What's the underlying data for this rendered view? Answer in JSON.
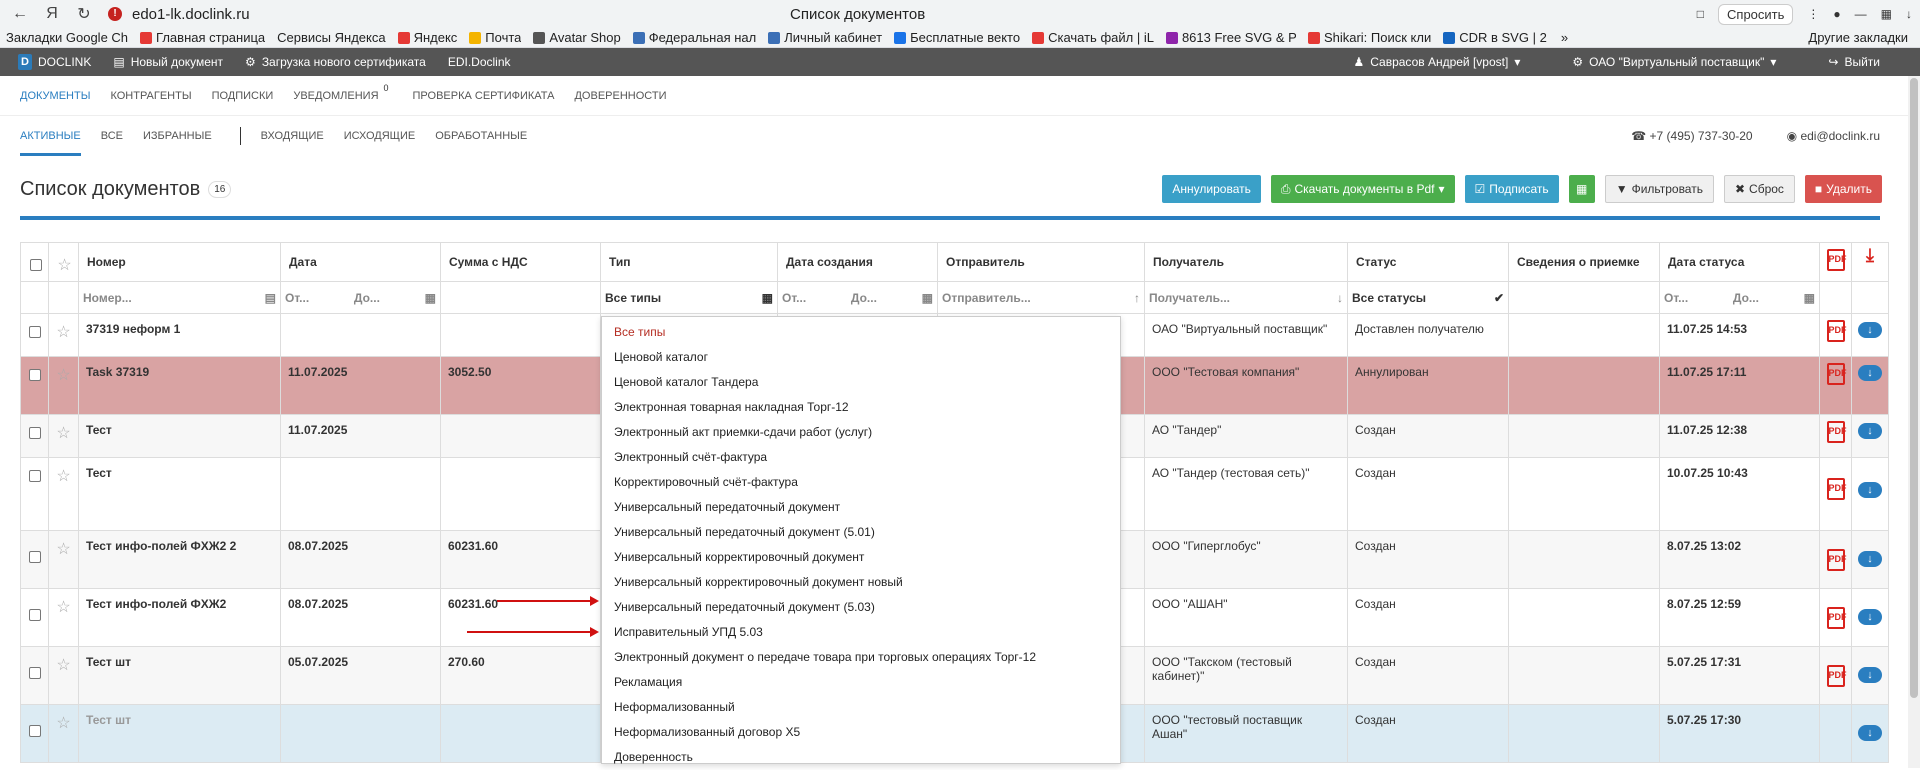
{
  "browser": {
    "url": "edo1-lk.doclink.ru",
    "tab_title": "Список документов",
    "ask_label": "Спросить",
    "bookmarks": [
      "Закладки Google Ch",
      "Главная страница",
      "Сервисы Яндекса",
      "Яндекс",
      "Почта",
      "Avatar Shop",
      "Федеральная нал",
      "Личный кабинет",
      "Бесплатные векто",
      "Скачать файл | iL",
      "8613 Free SVG & P",
      "Shikari: Поиск кли",
      "CDR в SVG | 2"
    ],
    "other_bookmarks": "Другие закладки"
  },
  "appbar": {
    "brand": "DOCLINK",
    "new_doc": "Новый документ",
    "upload_cert": "Загрузка нового сертификата",
    "edi": "EDI.Doclink",
    "user": "Саврасов Андрей [vpost]",
    "org": "ОАО \"Виртуальный поставщик\"",
    "logout": "Выйти"
  },
  "mainnav": [
    "ДОКУМЕНТЫ",
    "КОНТРАГЕНТЫ",
    "ПОДПИСКИ",
    "УВЕДОМЛЕНИЯ",
    "ПРОВЕРКА СЕРТИФИКАТА",
    "ДОВЕРЕННОСТИ"
  ],
  "notifications_count": "0",
  "subnav": [
    "АКТИВНЫЕ",
    "ВСЕ",
    "ИЗБРАННЫЕ",
    "ВХОДЯЩИЕ",
    "ИСХОДЯЩИЕ",
    "ОБРАБОТАННЫЕ"
  ],
  "contacts": {
    "phone": "+7 (495) 737-30-20",
    "email": "edi@doclink.ru"
  },
  "page": {
    "title": "Список документов",
    "count": "16"
  },
  "actions": {
    "annul": "Аннулировать",
    "download_pdf": "Скачать документы в Pdf",
    "sign": "Подписать",
    "filter": "Фильтровать",
    "reset": "Сброс",
    "delete": "Удалить"
  },
  "columns": [
    "Номер",
    "Дата",
    "Сумма с НДС",
    "Тип",
    "Дата создания",
    "Отправитель",
    "Получатель",
    "Статус",
    "Сведения о приемке",
    "Дата статуса"
  ],
  "filters": {
    "number": "Номер...",
    "from": "От...",
    "to": "До...",
    "type": "Все типы",
    "sender": "Отправитель...",
    "receiver": "Получатель...",
    "status": "Все статусы"
  },
  "rows": [
    {
      "number": "37319 неформ 1",
      "date": "",
      "sum": "",
      "receiver": "ОАО \"Виртуальный поставщик\"",
      "status": "Доставлен получателю",
      "status_date": "11.07.25 14:53"
    },
    {
      "number": "Task 37319",
      "date": "11.07.2025",
      "sum": "3052.50",
      "receiver": "ООО \"Тестовая компания\"",
      "status": "Аннулирован",
      "status_date": "11.07.25 17:11"
    },
    {
      "number": "Тест",
      "date": "11.07.2025",
      "sum": "",
      "receiver": "АО \"Тандер\"",
      "status": "Создан",
      "status_date": "11.07.25 12:38"
    },
    {
      "number": "Тест",
      "date": "",
      "sum": "",
      "receiver": "АО \"Тандер (тестовая сеть)\"",
      "status": "Создан",
      "status_date": "10.07.25 10:43"
    },
    {
      "number": "Тест инфо-полей ФХЖ2 2",
      "date": "08.07.2025",
      "sum": "60231.60",
      "receiver": "ООО \"Гиперглобус\"",
      "status": "Создан",
      "status_date": "8.07.25 13:02"
    },
    {
      "number": "Тест инфо-полей ФХЖ2",
      "date": "08.07.2025",
      "sum": "60231.60",
      "receiver": "ООО \"АШАН\"",
      "status": "Создан",
      "status_date": "8.07.25 12:59"
    },
    {
      "number": "Тест шт",
      "date": "05.07.2025",
      "sum": "270.60",
      "receiver": "ООО \"Такском (тестовый кабинет)\"",
      "status": "Создан",
      "status_date": "5.07.25 17:31"
    },
    {
      "number": "Тест шт",
      "date": "",
      "sum": "",
      "receiver": "ООО \"тестовый поставщик Ашан\"",
      "status": "Создан",
      "status_date": "5.07.25 17:30"
    }
  ],
  "type_options": [
    "Все типы",
    "Ценовой каталог",
    "Ценовой каталог Тандера",
    "Электронная товарная накладная Торг-12",
    "Электронный акт приемки-сдачи работ (услуг)",
    "Электронный счёт-фактура",
    "Корректировочный счёт-фактура",
    "Универсальный передаточный документ",
    "Универсальный передаточный документ (5.01)",
    "Универсальный корректировочный документ",
    "Универсальный корректировочный документ новый",
    "Универсальный передаточный документ (5.03)",
    "Исправительный УПД 5.03",
    "Электронный документ о передаче товара при торговых операциях Торг-12",
    "Рекламация",
    "Неформализованный",
    "Неформализованный договор X5",
    "Доверенность"
  ],
  "colors": {
    "accent": "#2a7ec0",
    "danger": "#d9534f",
    "success": "#4cae4c",
    "info": "#3aa0c8",
    "annulled_row": "#d9a3a3",
    "arrow": "#d01010"
  }
}
